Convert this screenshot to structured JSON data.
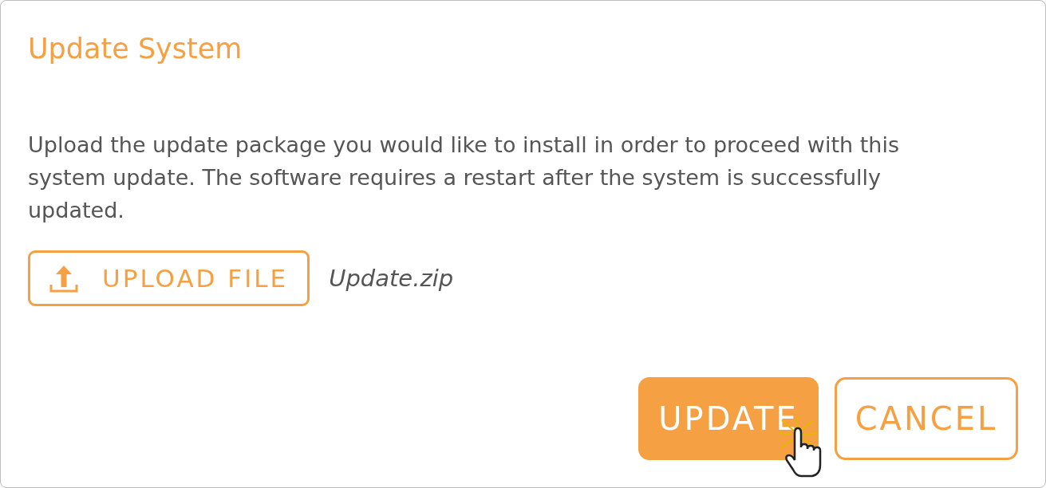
{
  "dialog": {
    "title": "Update System",
    "message": "Upload the update package you would like to install in order to proceed with this system update. The software requires a restart after the system is successfully updated.",
    "upload": {
      "label": "UPLOAD FILE",
      "file_name": "Update.zip"
    },
    "buttons": [
      {
        "label": "UPDATE",
        "kind": "primary"
      },
      {
        "label": "CANCEL",
        "kind": "outline"
      }
    ]
  }
}
